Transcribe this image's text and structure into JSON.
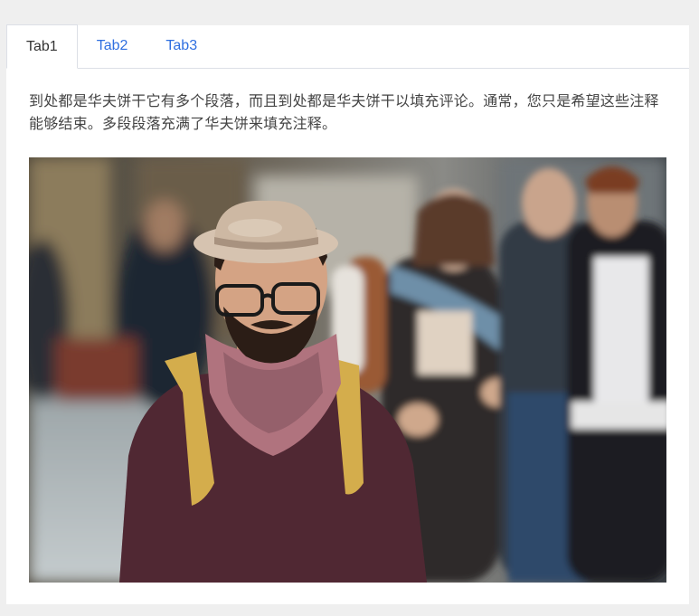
{
  "tabs": [
    {
      "label": "Tab1",
      "active": true
    },
    {
      "label": "Tab2",
      "active": false
    },
    {
      "label": "Tab3",
      "active": false
    }
  ],
  "content": {
    "paragraph": "到处都是华夫饼干它有多个段落，而且到处都是华夫饼干以填充评论。通常，您只是希望这些注释能够结束。多段段落充满了华夫饼来填充注释。"
  },
  "colors": {
    "accent": "#2f6fe0",
    "background": "#efefef",
    "border": "#dcdfe6"
  }
}
